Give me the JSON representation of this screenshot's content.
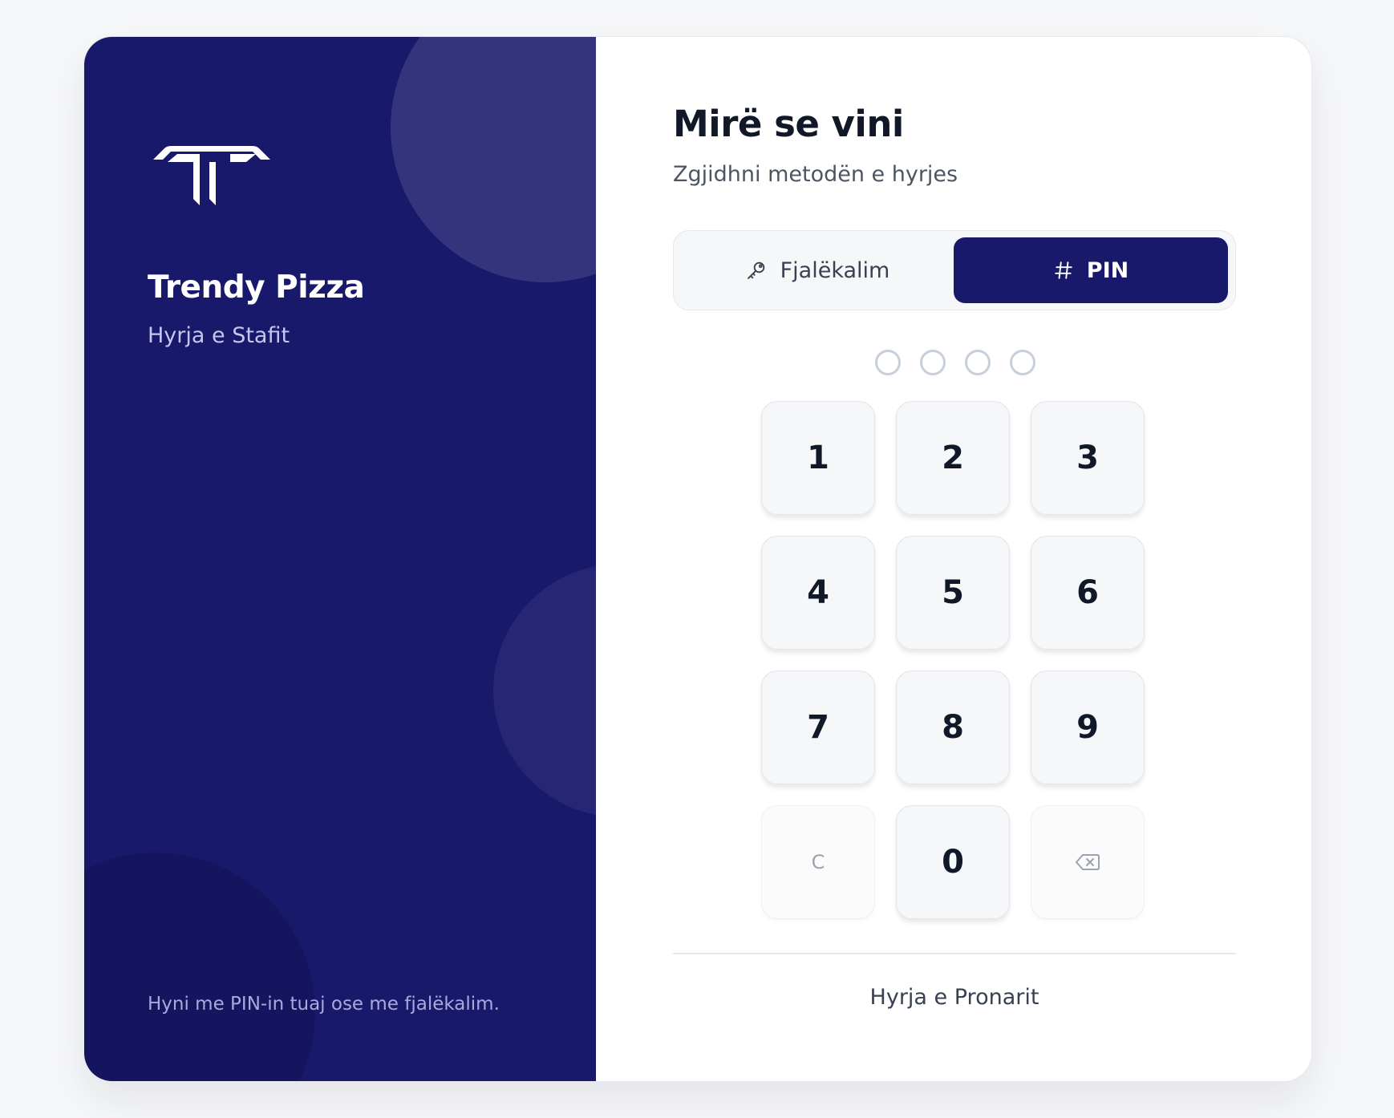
{
  "brand": {
    "name": "Trendy Pizza",
    "subtitle": "Hyrja e Stafit",
    "footer": "Hyni me PIN-in tuaj ose me fjalëkalim.",
    "logo_icon": "trendy-t-logo",
    "color": "#19196C"
  },
  "login": {
    "title": "Mirë se vini",
    "subtitle": "Zgjidhni metodën e hyrjes",
    "tabs": [
      {
        "label": "Fjalëkalim",
        "icon": "key-icon",
        "active": false
      },
      {
        "label": "PIN",
        "icon": "hash-icon",
        "active": true
      }
    ],
    "pin_entered": 0,
    "pin_length": 4,
    "keypad": {
      "keys": [
        "1",
        "2",
        "3",
        "4",
        "5",
        "6",
        "7",
        "8",
        "9"
      ],
      "clear_label": "C",
      "zero_label": "0",
      "backspace_icon": "backspace-icon"
    },
    "owner_link": "Hyrja e Pronarit"
  }
}
